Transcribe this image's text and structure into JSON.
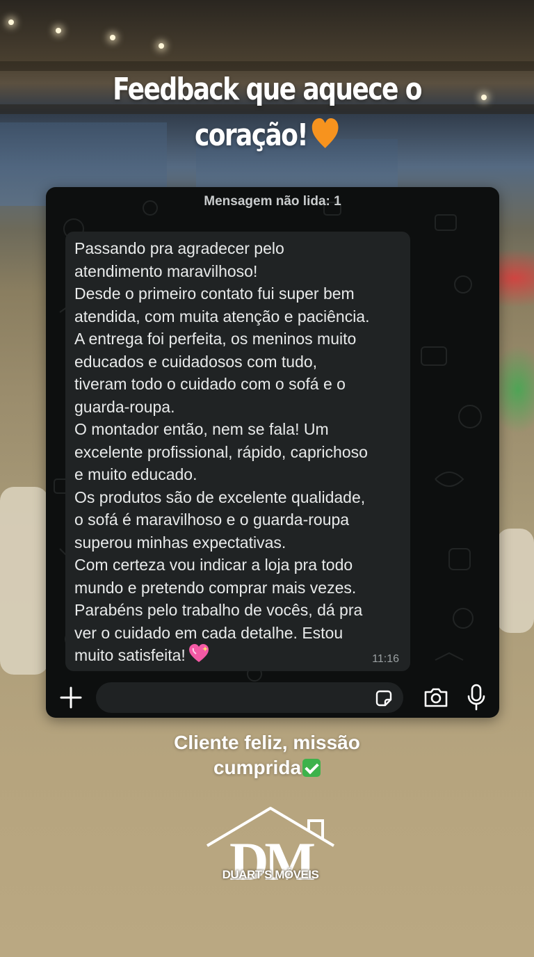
{
  "headline": {
    "line1": "Feedback que aquece o",
    "line2": "coração!",
    "emoji": "orange-heart"
  },
  "chat": {
    "unread_banner": "Mensagem não lida: 1",
    "message": {
      "lines": [
        "Passando pra agradecer pelo",
        "atendimento maravilhoso!",
        "Desde o primeiro contato fui super bem",
        "atendida, com muita atenção e paciência.",
        "A entrega foi perfeita, os meninos muito",
        "educados e cuidadosos com tudo,",
        "tiveram todo o cuidado com o sofá e o",
        "guarda-roupa.",
        "O montador então, nem se fala! Um",
        "excelente profissional, rápido, caprichoso",
        "e muito educado.",
        "Os produtos são de excelente qualidade,",
        "o sofá é maravilhoso e o guarda-roupa",
        "superou minhas expectativas.",
        "Com certeza vou indicar a loja pra todo",
        "mundo e pretendo comprar mais vezes.",
        "Parabéns pelo trabalho de vocês, dá pra",
        "ver o cuidado em cada detalhe. Estou",
        "muito satisfeita!"
      ],
      "emoji": "sparkling-heart",
      "time": "11:16"
    },
    "input": {
      "placeholder": ""
    }
  },
  "caption": {
    "line1": "Cliente feliz, missão",
    "line2": "cumprida",
    "emoji": "check-mark-button"
  },
  "logo": {
    "monogram": "DM",
    "name": "DUART'S MÓVEIS"
  },
  "colors": {
    "chat_bg": "#0d0f0f",
    "bubble_bg": "#202324",
    "check_green": "#3db24b",
    "heart_orange": "#f7931e"
  }
}
